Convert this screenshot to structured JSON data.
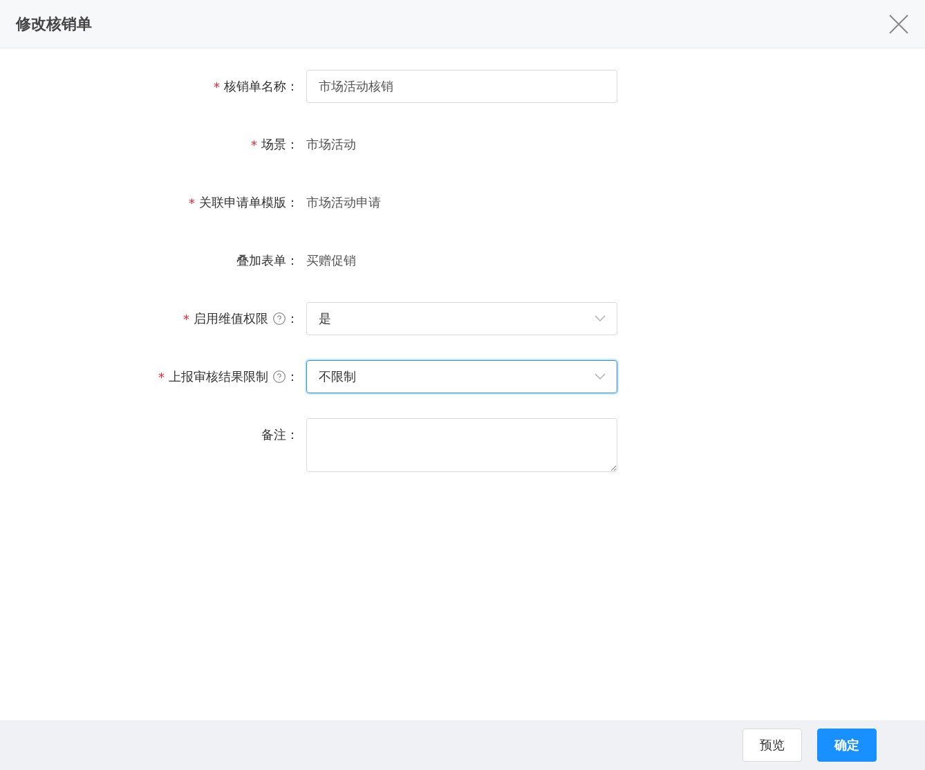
{
  "dialog": {
    "title": "修改核销单"
  },
  "fields": [
    {
      "kind": "input",
      "required_mark": "*",
      "label": "核销单名称：",
      "help": false,
      "value": "市场活动核销",
      "focused": false
    },
    {
      "kind": "text",
      "required_mark": "*",
      "label": "场景：",
      "help": false,
      "value": "市场活动"
    },
    {
      "kind": "text",
      "required_mark": "*",
      "label": "关联申请单模版：",
      "help": false,
      "value": "市场活动申请"
    },
    {
      "kind": "text",
      "label": "叠加表单：",
      "help": false,
      "value": "买赠促销"
    },
    {
      "kind": "select",
      "required_mark": "*",
      "label": "启用维值权限",
      "help": true,
      "colon": "：",
      "value": "是",
      "focused": false
    },
    {
      "kind": "select",
      "required_mark": "*",
      "label": "上报审核结果限制",
      "help": true,
      "colon": "：",
      "value": "不限制",
      "focused": true
    },
    {
      "kind": "textarea",
      "label": "备注：",
      "help": false,
      "focused": false
    }
  ],
  "footer": {
    "buttons": [
      {
        "label": "预览",
        "primary": false
      },
      {
        "label": "确定",
        "primary": true
      }
    ]
  }
}
